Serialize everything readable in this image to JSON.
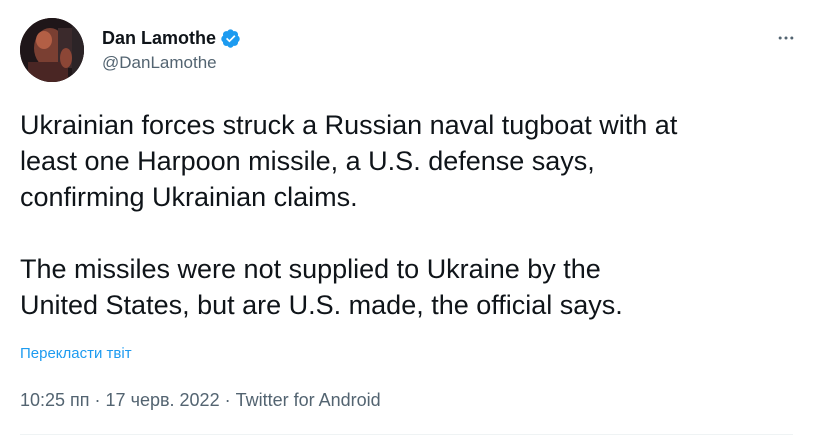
{
  "author": {
    "name": "Dan Lamothe",
    "handle": "@DanLamothe",
    "verified": true
  },
  "tweet": {
    "paragraphs": [
      "Ukrainian forces struck a Russian naval tugboat with at\nleast one Harpoon missile, a U.S. defense says,\nconfirming Ukrainian claims.",
      "The missiles were not supplied to Ukraine by the\nUnited States, but are U.S. made, the official says."
    ],
    "translate_label": "Перекласти твіт",
    "time": "10:25 пп",
    "separator": "·",
    "date": "17 черв. 2022",
    "source": "Twitter for Android"
  },
  "icons": {
    "verified": "verified-badge-icon",
    "more": "more-options-icon"
  },
  "colors": {
    "accent": "#1d9bf0",
    "text": "#0f1419",
    "secondary": "#536471"
  }
}
